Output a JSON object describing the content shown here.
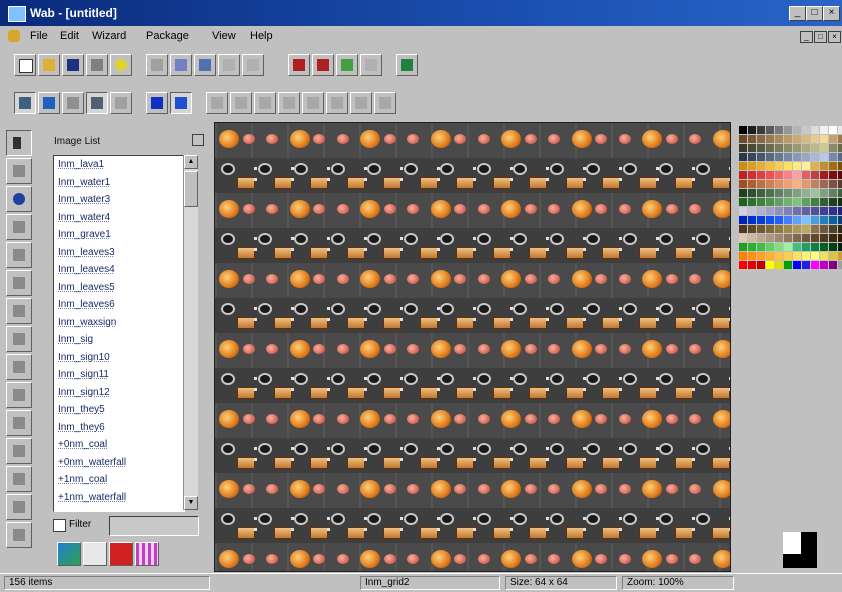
{
  "window": {
    "title": "Wab - [untitled]"
  },
  "menu": [
    "File",
    "Edit",
    "Wizard",
    "Package",
    "View",
    "Help"
  ],
  "image_list": {
    "title": "Image List",
    "items": [
      "Inm_lava1",
      "Inm_water1",
      "Inm_water3",
      "Inm_water4",
      "Inm_grave1",
      "Inm_leaves3",
      "Inm_leaves4",
      "Inm_leaves5",
      "Inm_leaves6",
      "Inm_waxsign",
      "Inm_sig",
      "Inm_sign10",
      "Inm_sign11",
      "Inm_sign12",
      "Inm_they5",
      "Inm_they6",
      "+0nm_coal",
      "+0nm_waterfall",
      "+1nm_coal",
      "+1nm_waterfall"
    ],
    "filter_label": "Filter",
    "filter_value": ""
  },
  "status": {
    "count": "156 items",
    "name": "Inm_grid2",
    "size": "Size: 64 x 64",
    "zoom": "Zoom: 100%"
  },
  "colors": {
    "title_start": "#0a2a7a",
    "title_end": "#2a64c8",
    "canvas": "#4e4e4e",
    "chrome": "#c0c0c0"
  },
  "palette": [
    "#000000",
    "#1e1e1e",
    "#3c3c3c",
    "#5a5a5a",
    "#787878",
    "#969696",
    "#b4b4b4",
    "#c8c8c8",
    "#dcdcdc",
    "#f0f0f0",
    "#ffffff",
    "#e8e8e8",
    "#d0d0d0",
    "#6b4a2a",
    "#7a5a36",
    "#8a6a42",
    "#9a7a4e",
    "#aa8a5a",
    "#ba9a66",
    "#caaa72",
    "#dab97e",
    "#eac98a",
    "#f6d996",
    "#c8a070",
    "#a07850",
    "#785030",
    "#3a3a2a",
    "#4a4a36",
    "#5a5a42",
    "#6a6a4e",
    "#7a7a5a",
    "#8a8a66",
    "#9a9a72",
    "#aaaa7e",
    "#baba8a",
    "#caca96",
    "#8a8a6a",
    "#6a6a4a",
    "#4a4a3a",
    "#283848",
    "#38485a",
    "#48586c",
    "#58687e",
    "#687890",
    "#7888a2",
    "#8898b4",
    "#98a8c6",
    "#a8b8d8",
    "#b8c8ea",
    "#7888a8",
    "#586888",
    "#384868",
    "#c89010",
    "#d8a020",
    "#e8b030",
    "#f0c040",
    "#f8d050",
    "#ffe060",
    "#ffe880",
    "#fff0a0",
    "#e0b050",
    "#c09030",
    "#a07010",
    "#805000",
    "#603000",
    "#c02020",
    "#d03030",
    "#e04040",
    "#f05050",
    "#ff6060",
    "#ff8080",
    "#ffa0a0",
    "#e06060",
    "#c04040",
    "#a02020",
    "#801010",
    "#600808",
    "#400404",
    "#a05020",
    "#b06030",
    "#c07040",
    "#d08050",
    "#e09060",
    "#f0a070",
    "#ffb080",
    "#e09870",
    "#c08060",
    "#a06850",
    "#805040",
    "#603830",
    "#402020",
    "#204020",
    "#305030",
    "#406040",
    "#507050",
    "#608060",
    "#709070",
    "#80a080",
    "#90b090",
    "#a0c0a0",
    "#80a080",
    "#608060",
    "#406040",
    "#204020",
    "#206020",
    "#307030",
    "#408040",
    "#509050",
    "#60a060",
    "#70b070",
    "#80c080",
    "#60a060",
    "#408040",
    "#306030",
    "#204020",
    "#103010",
    "#082008",
    "#d0d0e0",
    "#c0c0d8",
    "#b0b0d0",
    "#a0a0c8",
    "#9090c0",
    "#8080b8",
    "#7070b0",
    "#6060a8",
    "#5050a0",
    "#404098",
    "#303090",
    "#202088",
    "#101080",
    "#0020c0",
    "#0030d0",
    "#0040e0",
    "#1050f0",
    "#2060ff",
    "#4080ff",
    "#60a0ff",
    "#80c0ff",
    "#40a0e0",
    "#2080c0",
    "#1060a0",
    "#084080",
    "#042060",
    "#503820",
    "#604828",
    "#705830",
    "#806838",
    "#907840",
    "#a08848",
    "#b09850",
    "#c0a858",
    "#907048",
    "#705838",
    "#504028",
    "#302818",
    "#201810",
    "#e0c8b0",
    "#d0b8a0",
    "#c0a890",
    "#b09880",
    "#a08870",
    "#907860",
    "#806850",
    "#705840",
    "#604830",
    "#503820",
    "#402810",
    "#301808",
    "#201004",
    "#20a020",
    "#30b030",
    "#40c040",
    "#60d060",
    "#80e080",
    "#a0f0a0",
    "#40c080",
    "#20a060",
    "#108040",
    "#086020",
    "#044010",
    "#022008",
    "#011004",
    "#ff8000",
    "#ff9010",
    "#ffa020",
    "#ffb030",
    "#ffc040",
    "#ffd050",
    "#ffe060",
    "#fff070",
    "#ffff80",
    "#f0e060",
    "#e0c040",
    "#d0a020",
    "#c08000",
    "#ff0000",
    "#e00000",
    "#c00000",
    "#ffff00",
    "#e0e000",
    "#00a000",
    "#0000ff",
    "#2020e0",
    "#ff00ff",
    "#c000c0",
    "#800080",
    "#a0a0a0",
    "#606060"
  ]
}
